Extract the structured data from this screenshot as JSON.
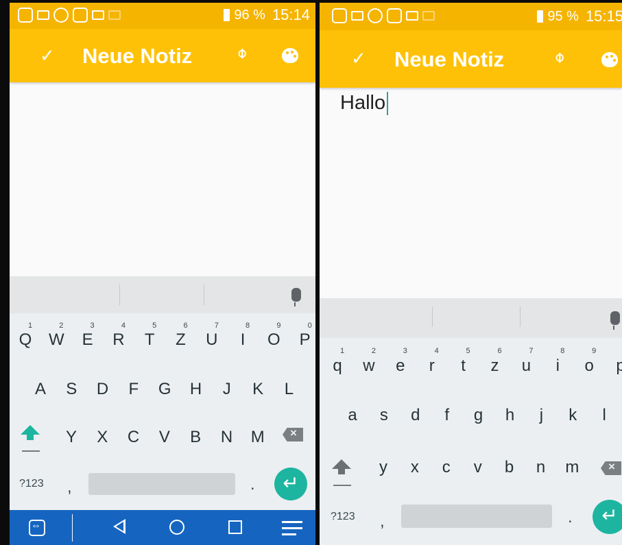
{
  "left": {
    "status": {
      "battery": "96 %",
      "time": "15:14"
    },
    "appbar": {
      "check": "✓",
      "title": "Neue Notiz",
      "clip": "⌽"
    },
    "note": {
      "text": ""
    },
    "keyboard": {
      "row1": [
        {
          "k": "Q",
          "n": "1"
        },
        {
          "k": "W",
          "n": "2"
        },
        {
          "k": "E",
          "n": "3"
        },
        {
          "k": "R",
          "n": "4"
        },
        {
          "k": "T",
          "n": "5"
        },
        {
          "k": "Z",
          "n": "6"
        },
        {
          "k": "U",
          "n": "7"
        },
        {
          "k": "I",
          "n": "8"
        },
        {
          "k": "O",
          "n": "9"
        },
        {
          "k": "P",
          "n": "0"
        }
      ],
      "row2": [
        "A",
        "S",
        "D",
        "F",
        "G",
        "H",
        "J",
        "K",
        "L"
      ],
      "row3": [
        "Y",
        "X",
        "C",
        "V",
        "B",
        "N",
        "M"
      ],
      "sym": "?123",
      "comma": ",",
      "dot": ".",
      "backspace": "×"
    }
  },
  "right": {
    "status": {
      "battery": "95 %",
      "time": "15:15"
    },
    "appbar": {
      "check": "✓",
      "title": "Neue Notiz",
      "clip": "⌽"
    },
    "note": {
      "text": "Hallo"
    },
    "keyboard": {
      "row1": [
        {
          "k": "q",
          "n": "1"
        },
        {
          "k": "w",
          "n": "2"
        },
        {
          "k": "e",
          "n": "3"
        },
        {
          "k": "r",
          "n": "4"
        },
        {
          "k": "t",
          "n": "5"
        },
        {
          "k": "z",
          "n": "6"
        },
        {
          "k": "u",
          "n": "7"
        },
        {
          "k": "i",
          "n": "8"
        },
        {
          "k": "o",
          "n": "9"
        },
        {
          "k": "p",
          "n": ""
        }
      ],
      "row2": [
        "a",
        "s",
        "d",
        "f",
        "g",
        "h",
        "j",
        "k",
        "l"
      ],
      "row3": [
        "y",
        "x",
        "c",
        "v",
        "b",
        "n",
        "m"
      ],
      "sym": "?123",
      "comma": ",",
      "dot": ".",
      "backspace": "×"
    }
  },
  "colors": {
    "appbar": "#FFC107",
    "statusbar": "#F5B400",
    "accent": "#1DB5A0",
    "navbar": "#1565C0"
  },
  "icons": [
    "status-icons",
    "attach-icon",
    "palette-icon",
    "mic-icon",
    "shift-icon",
    "backspace-icon",
    "enter-icon",
    "teamviewer-icon",
    "back-icon",
    "home-icon",
    "recents-icon",
    "menu-icon"
  ]
}
